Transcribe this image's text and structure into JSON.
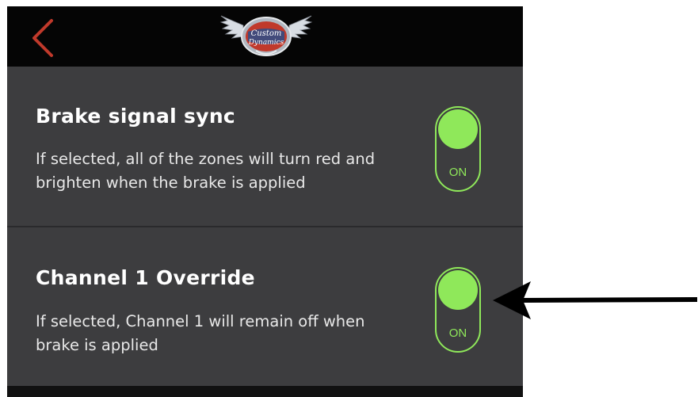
{
  "header": {
    "back_icon": "chevron-left-icon",
    "logo_text_line1": "Custom",
    "logo_text_line2": "Dynamics"
  },
  "settings": [
    {
      "title": "Brake signal sync",
      "description": "If selected, all of the zones will turn red and brighten when the brake is applied",
      "toggle_label": "ON",
      "enabled": true
    },
    {
      "title": "Channel 1 Override",
      "description": "If selected, Channel 1 will remain off when brake is applied",
      "toggle_label": "ON",
      "enabled": true
    }
  ],
  "colors": {
    "accent_green": "#8fe85a",
    "back_red": "#c0392b",
    "background": "#3d3d3f",
    "topbar": "#050505"
  }
}
